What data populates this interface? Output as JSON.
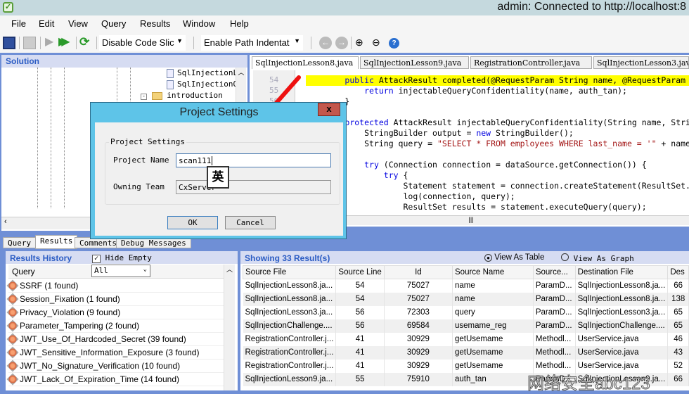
{
  "window": {
    "title": "admin: Connected to http://localhost:8"
  },
  "menu": [
    "File",
    "Edit",
    "View",
    "Query",
    "Results",
    "Window",
    "Help"
  ],
  "toolbar": {
    "code_slicing": "Disable Code Slic",
    "path_indent": "Enable Path Indentat"
  },
  "solution": {
    "title": "Solution",
    "tree": [
      "SqlInjectionL",
      "SqlInjectionQ",
      "introduction"
    ]
  },
  "editor": {
    "tabs": [
      "SqlInjectionLesson8.java",
      "SqlInjectionLesson9.java",
      "RegistrationController.java",
      "SqlInjectionLesson3.java"
    ],
    "lines": [
      {
        "n": "54",
        "hl": true,
        "segs": [
          [
            "        ",
            "pl"
          ],
          [
            "public ",
            "kw"
          ],
          [
            "AttackResult completed(@RequestParam String name, @RequestParam String auth_tan) {",
            "pl"
          ]
        ]
      },
      {
        "n": "55",
        "segs": [
          [
            "            ",
            "pl"
          ],
          [
            "return ",
            "kw"
          ],
          [
            "injectableQueryConfidentiality(name, auth_tan);",
            "pl"
          ]
        ]
      },
      {
        "n": "56",
        "segs": [
          [
            "        }",
            "pl"
          ]
        ]
      },
      {
        "n": "57",
        "segs": []
      },
      {
        "n": "58",
        "segs": [
          [
            "        ",
            "pl"
          ],
          [
            "protected ",
            "kw"
          ],
          [
            "AttackResult injectableQueryConfidentiality(String name, String auth_tan) {",
            "pl"
          ]
        ]
      },
      {
        "n": "59",
        "segs": [
          [
            "            StringBuilder output = ",
            "pl"
          ],
          [
            "new ",
            "kw"
          ],
          [
            "StringBuilder();",
            "pl"
          ]
        ]
      },
      {
        "n": "60",
        "segs": [
          [
            "            String query = ",
            "pl"
          ],
          [
            "\"SELECT * FROM employees WHERE last_name = '\"",
            "str"
          ],
          [
            " + name + \"' AND auth_tan = '\"",
            "pl"
          ]
        ]
      },
      {
        "n": "61",
        "segs": []
      },
      {
        "n": "62",
        "segs": [
          [
            "            ",
            "pl"
          ],
          [
            "try ",
            "kw"
          ],
          [
            "(Connection connection = dataSource.getConnection()) {",
            "pl"
          ]
        ]
      },
      {
        "n": "63",
        "segs": [
          [
            "                ",
            "pl"
          ],
          [
            "try ",
            "kw"
          ],
          [
            "{",
            "pl"
          ]
        ]
      },
      {
        "n": "64",
        "segs": [
          [
            "                    Statement statement = connection.createStatement(ResultSet.TYPE_SCROLL_INSENSITIVE",
            "pl"
          ]
        ]
      },
      {
        "n": "65",
        "segs": [
          [
            "                    log(connection, query);",
            "pl"
          ]
        ]
      },
      {
        "n": "66",
        "segs": [
          [
            "                    ResultSet results = statement.executeQuery(query);",
            "pl"
          ]
        ]
      }
    ]
  },
  "bottom_tabs": [
    "Query",
    "Results",
    "Comments",
    "Debug Messages"
  ],
  "history": {
    "title": "Results History",
    "hide_empty": "Hide Empty",
    "hide_empty_checked": true,
    "column": "Query",
    "filter": "All",
    "items": [
      "SSRF (1 found)",
      "Session_Fixation (1 found)",
      "Privacy_Violation (9 found)",
      "Parameter_Tampering (2 found)",
      "JWT_Use_Of_Hardcoded_Secret (39 found)",
      "JWT_Sensitive_Information_Exposure (3 found)",
      "JWT_No_Signature_Verification (10 found)",
      "JWT_Lack_Of_Expiration_Time (14 found)"
    ]
  },
  "results": {
    "title": "Showing 33 Result(s)",
    "view_table": "View As Table",
    "view_graph": "View As Graph",
    "selected_view": "table",
    "columns": [
      "Source File",
      "Source Line",
      "Id",
      "Source Name",
      "Source...",
      "Destination File",
      "Des"
    ],
    "rows": [
      [
        "SqlInjectionLesson8.ja...",
        "54",
        "75027",
        "name",
        "ParamD...",
        "SqlInjectionLesson8.ja...",
        "66"
      ],
      [
        "SqlInjectionLesson8.ja...",
        "54",
        "75027",
        "name",
        "ParamD...",
        "SqlInjectionLesson8.ja...",
        "138"
      ],
      [
        "SqlInjectionLesson3.ja...",
        "56",
        "72303",
        "query",
        "ParamD...",
        "SqlInjectionLesson3.ja...",
        "65"
      ],
      [
        "SqlInjectionChallenge....",
        "56",
        "69584",
        "usemame_reg",
        "ParamD...",
        "SqlInjectionChallenge....",
        "65"
      ],
      [
        "RegistrationController.j...",
        "41",
        "30929",
        "getUsemame",
        "Methodl...",
        "UserService.java",
        "46"
      ],
      [
        "RegistrationController.j...",
        "41",
        "30929",
        "getUsemame",
        "Methodl...",
        "UserService.java",
        "43"
      ],
      [
        "RegistrationController.j...",
        "41",
        "30929",
        "getUsemame",
        "Methodl...",
        "UserService.java",
        "52"
      ],
      [
        "SqlInjectionLesson9.ja...",
        "55",
        "75910",
        "auth_tan",
        "ParamD...",
        "SqlInjectionLesson9.ja...",
        "66"
      ]
    ]
  },
  "dialog": {
    "title": "Project Settings",
    "group": "Project Settings",
    "name_label": "Project Name",
    "name_value": "scan111",
    "team_label": "Owning Team",
    "team_value": "CxServer",
    "ok": "OK",
    "cancel": "Cancel",
    "close": "x",
    "ime": "英"
  },
  "watermark": "网络安全abc123"
}
